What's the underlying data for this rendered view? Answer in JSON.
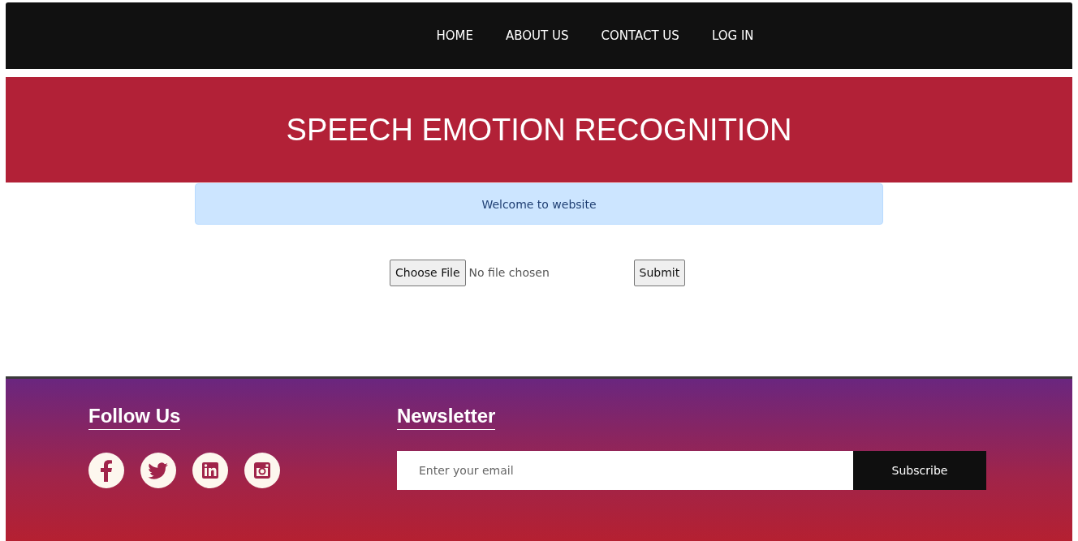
{
  "nav": {
    "items": [
      "HOME",
      "ABOUT US",
      "CONTACT US",
      "LOG IN"
    ]
  },
  "banner": {
    "title": "SPEECH EMOTION RECOGNITION"
  },
  "alert": {
    "text": "Welcome to website"
  },
  "upload": {
    "choose_button": "Choose File",
    "file_status": "No file chosen",
    "submit_button": "Submit"
  },
  "footer": {
    "follow_heading": "Follow Us",
    "social": [
      {
        "kind": "facebook"
      },
      {
        "kind": "twitter"
      },
      {
        "kind": "linkedin"
      },
      {
        "kind": "instagram"
      }
    ],
    "newsletter_heading": "Newsletter",
    "email": {
      "placeholder": "Enter your email"
    },
    "subscribe_button": "Subscribe"
  }
}
